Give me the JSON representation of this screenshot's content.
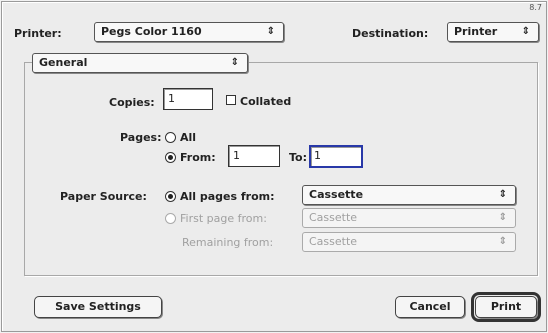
{
  "corner_text": "8.7",
  "printer": {
    "label": "Printer:",
    "selected": "Pegs Color 1160"
  },
  "destination": {
    "label": "Destination:",
    "selected": "Printer"
  },
  "panel": {
    "selected": "General"
  },
  "copies": {
    "label": "Copies:",
    "value": "1",
    "collated_label": "Collated"
  },
  "pages": {
    "label": "Pages:",
    "all_label": "All",
    "from_label": "From:",
    "from_value": "1",
    "to_label": "To:",
    "to_value": "1"
  },
  "paper_source": {
    "label": "Paper Source:",
    "all_pages_label": "All pages from:",
    "all_pages_value": "Cassette",
    "first_page_label": "First page from:",
    "first_page_value": "Cassette",
    "remaining_label": "Remaining from:",
    "remaining_value": "Cassette"
  },
  "buttons": {
    "save": "Save Settings",
    "cancel": "Cancel",
    "print": "Print"
  },
  "icons": {
    "popup_arrows": "⇕"
  }
}
